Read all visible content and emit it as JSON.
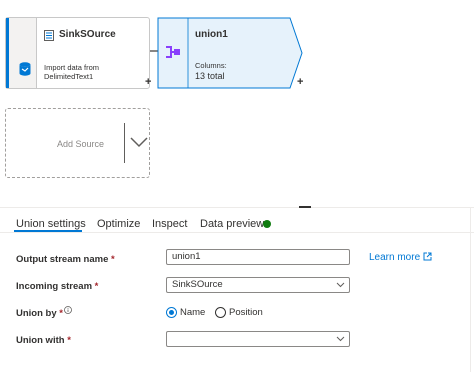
{
  "flow": {
    "source_node": {
      "name": "SinkSOurce",
      "description": "Import data from DelimitedText1",
      "icon": "database-icon"
    },
    "union_node": {
      "name": "union1",
      "columns_label": "Columns:",
      "columns_value": "13 total",
      "icon": "union-icon"
    },
    "add_source": {
      "label": "Add Source"
    },
    "plus_label": "+"
  },
  "tabs": [
    {
      "label": "Union settings",
      "active": true
    },
    {
      "label": "Optimize",
      "active": false
    },
    {
      "label": "Inspect",
      "active": false
    },
    {
      "label": "Data preview",
      "active": false,
      "status": "ready"
    }
  ],
  "form": {
    "output_stream_name": {
      "label": "Output stream name",
      "required": "*",
      "value": "union1"
    },
    "learn_more": "Learn more",
    "incoming_stream": {
      "label": "Incoming stream",
      "required": "*",
      "value": "SinkSOurce"
    },
    "union_by": {
      "label": "Union by",
      "required": "*",
      "options": [
        "Name",
        "Position"
      ],
      "selected": "Name"
    },
    "union_with": {
      "label": "Union with",
      "required": "*",
      "value": ""
    }
  },
  "colors": {
    "accent": "#0078d4",
    "union_fill": "#e6f2fb",
    "status_ok": "#107c10",
    "required": "#a4262c"
  }
}
